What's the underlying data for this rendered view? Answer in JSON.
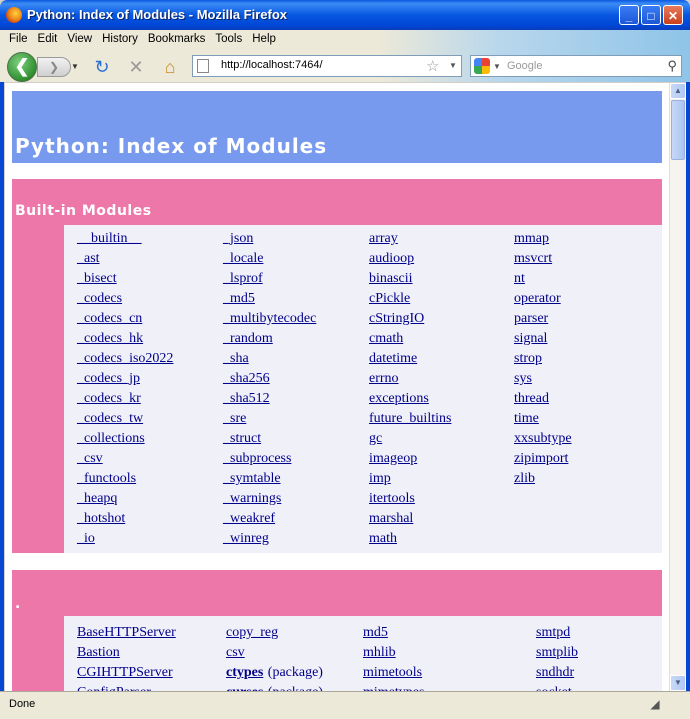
{
  "window": {
    "title": "Python: Index of Modules - Mozilla Firefox",
    "minimize": "_",
    "maximize": "□",
    "close": "✕"
  },
  "menu": [
    "File",
    "Edit",
    "View",
    "History",
    "Bookmarks",
    "Tools",
    "Help"
  ],
  "toolbar": {
    "url": "http://localhost:7464/",
    "search_placeholder": "Google"
  },
  "page": {
    "title": "Python: Index of Modules",
    "builtin_heading": "Built-in Modules",
    "builtin_columns": [
      [
        "__builtin__",
        "_ast",
        "_bisect",
        "_codecs",
        "_codecs_cn",
        "_codecs_hk",
        "_codecs_iso2022",
        "_codecs_jp",
        "_codecs_kr",
        "_codecs_tw",
        "_collections",
        "_csv",
        "_functools",
        "_heapq",
        "_hotshot",
        "_io"
      ],
      [
        "_json",
        "_locale",
        "_lsprof",
        "_md5",
        "_multibytecodec",
        "_random",
        "_sha",
        "_sha256",
        "_sha512",
        "_sre",
        "_struct",
        "_subprocess",
        "_symtable",
        "_warnings",
        "_weakref",
        "_winreg"
      ],
      [
        "array",
        "audioop",
        "binascii",
        "cPickle",
        "cStringIO",
        "cmath",
        "datetime",
        "errno",
        "exceptions",
        "future_builtins",
        "gc",
        "imageop",
        "imp",
        "itertools",
        "marshal",
        "math"
      ],
      [
        "mmap",
        "msvcrt",
        "nt",
        "operator",
        "parser",
        "signal",
        "strop",
        "sys",
        "thread",
        "time",
        "xxsubtype",
        "zipimport",
        "zlib"
      ]
    ],
    "dot_heading": ".",
    "dot_columns": [
      [
        {
          "name": "BaseHTTPServer"
        },
        {
          "name": "Bastion"
        },
        {
          "name": "CGIHTTPServer"
        },
        {
          "name": "ConfigParser"
        }
      ],
      [
        {
          "name": "copy_reg"
        },
        {
          "name": "csv"
        },
        {
          "name": "ctypes",
          "pkg": "(package)"
        },
        {
          "name": "curses",
          "pkg": "(package)"
        }
      ],
      [
        {
          "name": "md5"
        },
        {
          "name": "mhlib"
        },
        {
          "name": "mimetools"
        },
        {
          "name": "mimetypes"
        }
      ],
      [
        {
          "name": "smtpd"
        },
        {
          "name": "smtplib"
        },
        {
          "name": "sndhdr"
        },
        {
          "name": "socket"
        }
      ]
    ]
  },
  "status": {
    "text": "Done"
  }
}
